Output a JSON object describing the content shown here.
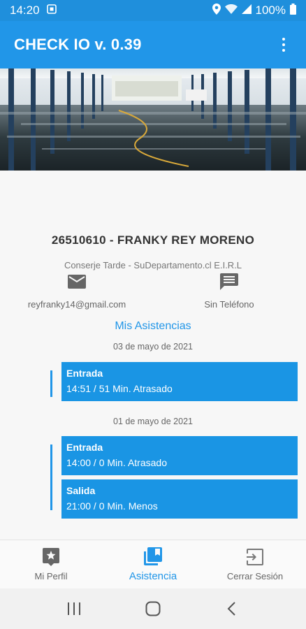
{
  "status_bar": {
    "time": "14:20",
    "battery": "100%"
  },
  "app_bar": {
    "title": "CHECK IO v. 0.39"
  },
  "profile": {
    "name": "26510610 - FRANKY REY MORENO",
    "role": "Conserje Tarde - SuDepartamento.cl E.I.R.L",
    "email": "reyfranky14@gmail.com",
    "phone": "Sin Teléfono"
  },
  "attendance": {
    "section_title": "Mis Asistencias",
    "days": [
      {
        "date": "03 de mayo de  2021",
        "entries": [
          {
            "type": "Entrada",
            "detail": "14:51 / 51 Min. Atrasado"
          }
        ]
      },
      {
        "date": "01 de mayo de  2021",
        "entries": [
          {
            "type": "Entrada",
            "detail": "14:00 / 0 Min. Atrasado"
          },
          {
            "type": "Salida",
            "detail": "21:00 / 0 Min. Menos"
          }
        ]
      }
    ]
  },
  "bottom_nav": {
    "profile_label": "Mi Perfil",
    "attendance_label": "Asistencia",
    "logout_label": "Cerrar Sesión"
  },
  "colors": {
    "primary": "#2196e8",
    "status_bar": "#1f8fdc",
    "card": "#1a95e4"
  },
  "icons": {
    "email": "email-icon",
    "phone": "message-icon",
    "profile": "profile-badge-icon",
    "attendance": "library-books-icon",
    "logout": "exit-icon"
  }
}
